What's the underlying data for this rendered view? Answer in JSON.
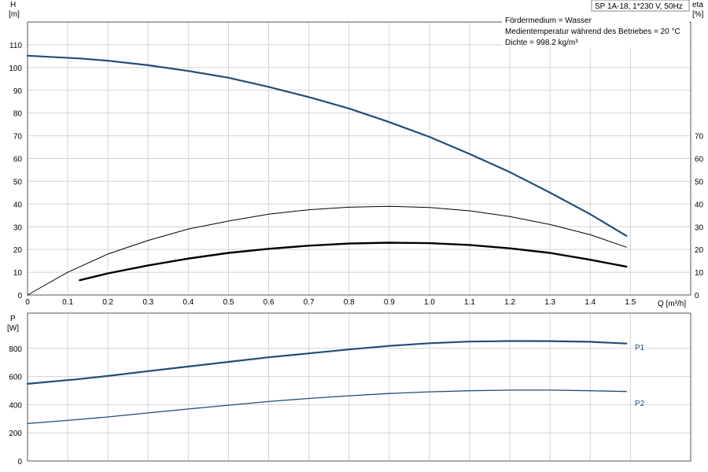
{
  "header": {
    "pump_title": "SP 1A-18, 1*230 V, 50Hz",
    "info_lines": [
      "Fördermedium = Wasser",
      "Medientemperatur während des Betriebes = 20 °C",
      "Dichte = 998.2 kg/m³"
    ]
  },
  "colors": {
    "blue": "#1f4e79",
    "black": "#000000",
    "grid": "#d4d4d4"
  },
  "chart_data": [
    {
      "type": "line",
      "panel": "top",
      "left_axis": {
        "label_top": "H",
        "label_unit": "[m]",
        "range": [
          0,
          120
        ],
        "ticks": [
          "0",
          "10",
          "20",
          "30",
          "40",
          "50",
          "60",
          "70",
          "80",
          "90",
          "100",
          "110"
        ]
      },
      "right_axis": {
        "label_top": "eta",
        "label_unit": "[%]",
        "range": [
          0,
          120
        ],
        "ticks": [
          "0",
          "10",
          "20",
          "30",
          "40",
          "50",
          "60",
          "70"
        ]
      },
      "x_axis": {
        "label": "Q [m³/h]",
        "range": [
          0,
          1.65
        ],
        "ticks": [
          "0",
          "0.1",
          "0.2",
          "0.3",
          "0.4",
          "0.5",
          "0.6",
          "0.7",
          "0.8",
          "0.9",
          "1.0",
          "1.1",
          "1.2",
          "1.3",
          "1.4",
          "1.5"
        ]
      },
      "grid": true,
      "series": [
        {
          "key": "H",
          "style": "blue-thick",
          "x": [
            0,
            0.13,
            0.2,
            0.3,
            0.4,
            0.5,
            0.6,
            0.7,
            0.8,
            0.9,
            1.0,
            1.1,
            1.2,
            1.3,
            1.4,
            1.49
          ],
          "y": [
            105.2,
            104,
            103,
            101,
            98.5,
            95.5,
            91.5,
            87,
            82,
            76,
            69.5,
            62,
            54,
            45,
            35.5,
            26
          ]
        },
        {
          "key": "eta_upper",
          "style": "black-thin",
          "x": [
            0,
            0.1,
            0.2,
            0.3,
            0.4,
            0.5,
            0.6,
            0.7,
            0.8,
            0.9,
            1.0,
            1.1,
            1.2,
            1.3,
            1.4,
            1.49
          ],
          "y": [
            0,
            10,
            18,
            24,
            29,
            32.5,
            35.5,
            37.5,
            38.6,
            39,
            38.5,
            37,
            34.5,
            31,
            26.5,
            21
          ]
        },
        {
          "key": "eta_lower",
          "style": "black-thick",
          "x": [
            0.13,
            0.2,
            0.3,
            0.4,
            0.5,
            0.6,
            0.7,
            0.8,
            0.9,
            1.0,
            1.1,
            1.2,
            1.3,
            1.4,
            1.49
          ],
          "y": [
            6.5,
            9.5,
            13,
            16,
            18.5,
            20.3,
            21.7,
            22.6,
            23,
            22.8,
            22,
            20.5,
            18.5,
            15.5,
            12.5
          ]
        }
      ]
    },
    {
      "type": "line",
      "panel": "bottom",
      "left_axis": {
        "label_top": "P",
        "label_unit": "[W]",
        "range": [
          0,
          1050
        ],
        "ticks": [
          "0",
          "200",
          "400",
          "600",
          "800"
        ]
      },
      "x_axis": {
        "range": [
          0,
          1.65
        ]
      },
      "grid": true,
      "series": [
        {
          "name": "P1",
          "style": "blue-thick",
          "x": [
            0,
            0.13,
            0.2,
            0.3,
            0.4,
            0.5,
            0.6,
            0.7,
            0.8,
            0.9,
            1.0,
            1.1,
            1.2,
            1.3,
            1.4,
            1.49
          ],
          "y": [
            548,
            582,
            604,
            638,
            671,
            704,
            736,
            764,
            792,
            817,
            836,
            848,
            852,
            851,
            846,
            834
          ]
        },
        {
          "name": "P2",
          "style": "blue-thin",
          "x": [
            0,
            0.1,
            0.2,
            0.3,
            0.4,
            0.5,
            0.6,
            0.7,
            0.8,
            0.9,
            1.0,
            1.1,
            1.2,
            1.3,
            1.4,
            1.49
          ],
          "y": [
            266,
            288,
            313,
            341,
            369,
            396,
            422,
            444,
            463,
            479,
            491,
            499,
            503,
            503,
            499,
            493
          ]
        }
      ]
    }
  ]
}
